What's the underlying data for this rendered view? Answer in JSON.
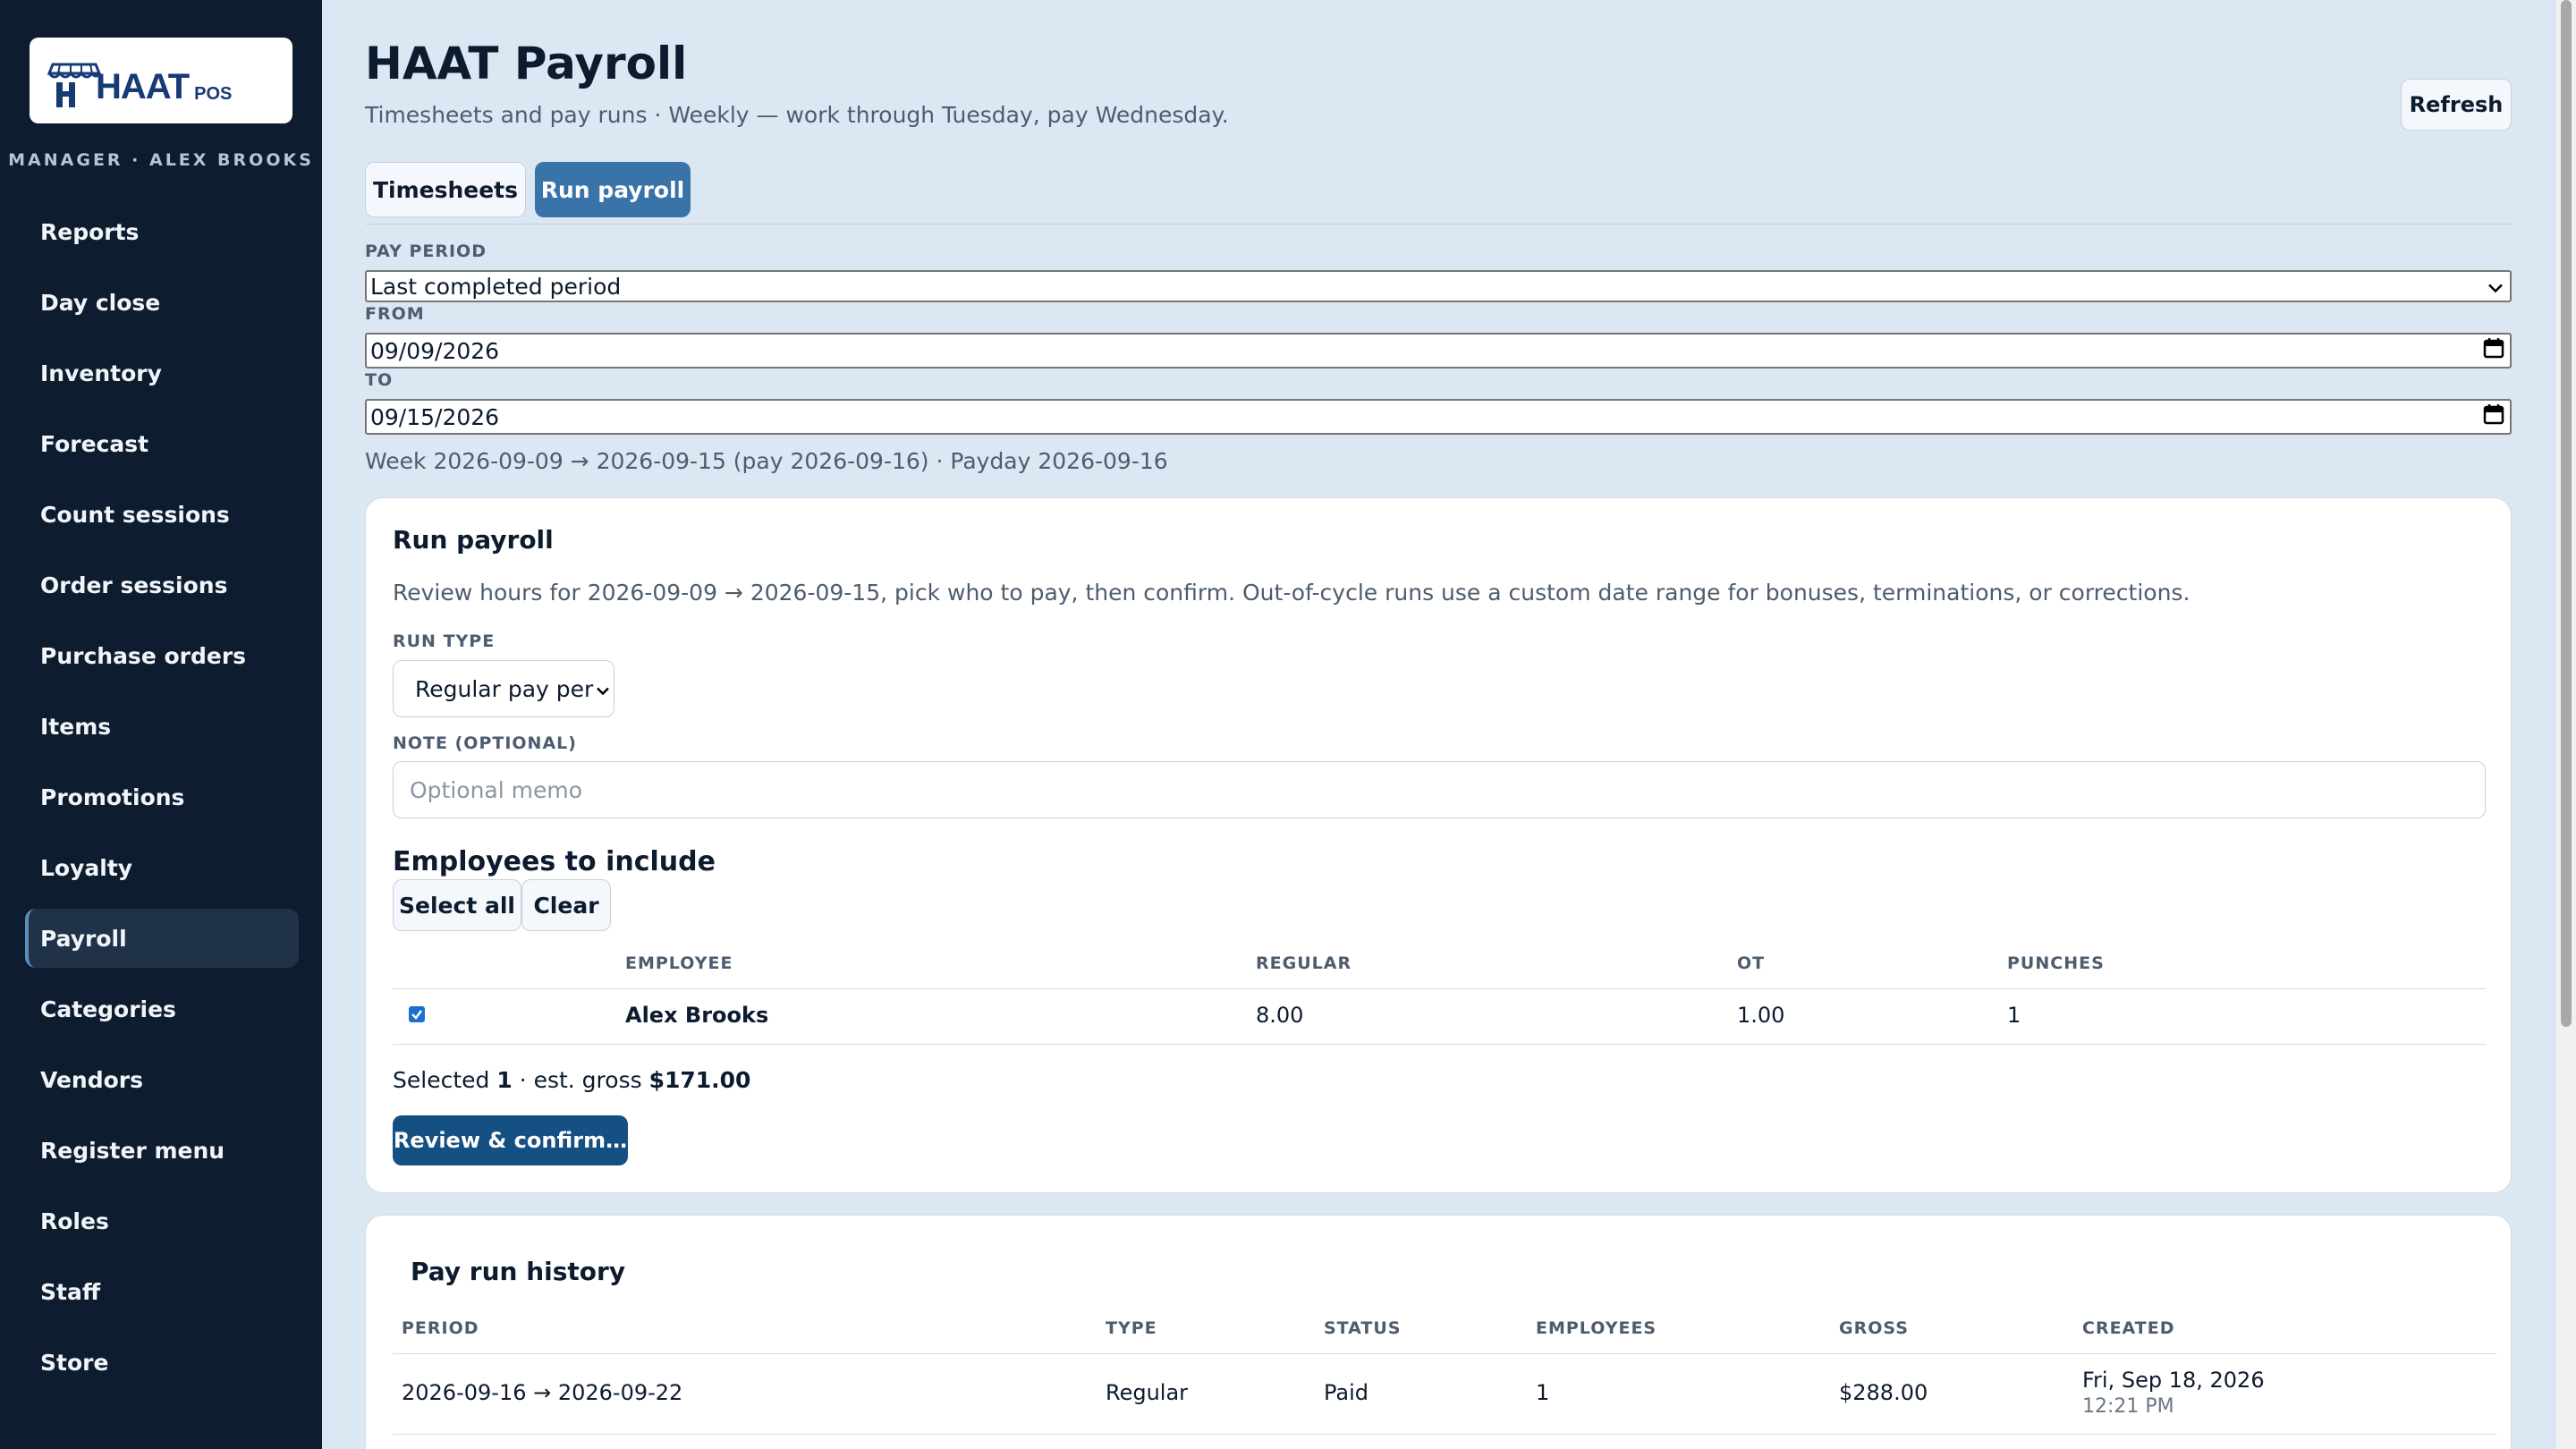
{
  "sidebar": {
    "logo": {
      "text": "HAAT",
      "sub": "POS"
    },
    "manager": "MANAGER · ALEX BROOKS",
    "items": [
      {
        "label": "Reports"
      },
      {
        "label": "Day close"
      },
      {
        "label": "Inventory"
      },
      {
        "label": "Forecast"
      },
      {
        "label": "Count sessions"
      },
      {
        "label": "Order sessions"
      },
      {
        "label": "Purchase orders"
      },
      {
        "label": "Items"
      },
      {
        "label": "Promotions"
      },
      {
        "label": "Loyalty"
      },
      {
        "label": "Payroll",
        "active": true
      },
      {
        "label": "Categories"
      },
      {
        "label": "Vendors"
      },
      {
        "label": "Register menu"
      },
      {
        "label": "Roles"
      },
      {
        "label": "Staff"
      },
      {
        "label": "Store"
      }
    ]
  },
  "header": {
    "title": "HAAT Payroll",
    "subtitle": "Timesheets and pay runs · Weekly — work through Tuesday, pay Wednesday.",
    "refresh": "Refresh"
  },
  "tabs": {
    "timesheets": "Timesheets",
    "run_payroll": "Run payroll"
  },
  "period": {
    "label": "PAY PERIOD",
    "value": "Last completed period",
    "from_label": "FROM",
    "from_value": "09/09/2026",
    "to_label": "TO",
    "to_value": "09/15/2026",
    "summary": "Week 2026-09-09 → 2026-09-15 (pay 2026-09-16) · Payday 2026-09-16"
  },
  "run": {
    "title": "Run payroll",
    "description": "Review hours for 2026-09-09 → 2026-09-15, pick who to pay, then confirm. Out-of-cycle runs use a custom date range for bonuses, terminations, or corrections.",
    "run_type_label": "RUN TYPE",
    "run_type_value": "Regular pay period",
    "note_label": "NOTE (OPTIONAL)",
    "note_placeholder": "Optional memo",
    "employees_heading": "Employees to include",
    "select_all": "Select all",
    "clear": "Clear",
    "columns": {
      "employee": "EMPLOYEE",
      "regular": "REGULAR",
      "ot": "OT",
      "punches": "PUNCHES"
    },
    "rows": [
      {
        "checked": true,
        "employee": "Alex Brooks",
        "regular": "8.00",
        "ot": "1.00",
        "punches": "1"
      }
    ],
    "selected_prefix": "Selected ",
    "selected_count": "1",
    "selected_mid": " · est. gross ",
    "selected_gross": "$171.00",
    "review_button": "Review & confirm…"
  },
  "history": {
    "title": "Pay run history",
    "columns": {
      "period": "PERIOD",
      "type": "TYPE",
      "status": "STATUS",
      "employees": "EMPLOYEES",
      "gross": "GROSS",
      "created": "CREATED"
    },
    "rows": [
      {
        "period": "2026-09-16 → 2026-09-22",
        "type": "Regular",
        "status": "Paid",
        "employees": "1",
        "gross": "$288.00",
        "created_date": "Fri, Sep 18, 2026",
        "created_time": "12:21 PM"
      }
    ]
  },
  "colors": {
    "sidebar_bg": "#0d1c2e",
    "accent": "#3a73a8",
    "primary_button": "#155082",
    "page_bg": "#dbe7f3"
  }
}
